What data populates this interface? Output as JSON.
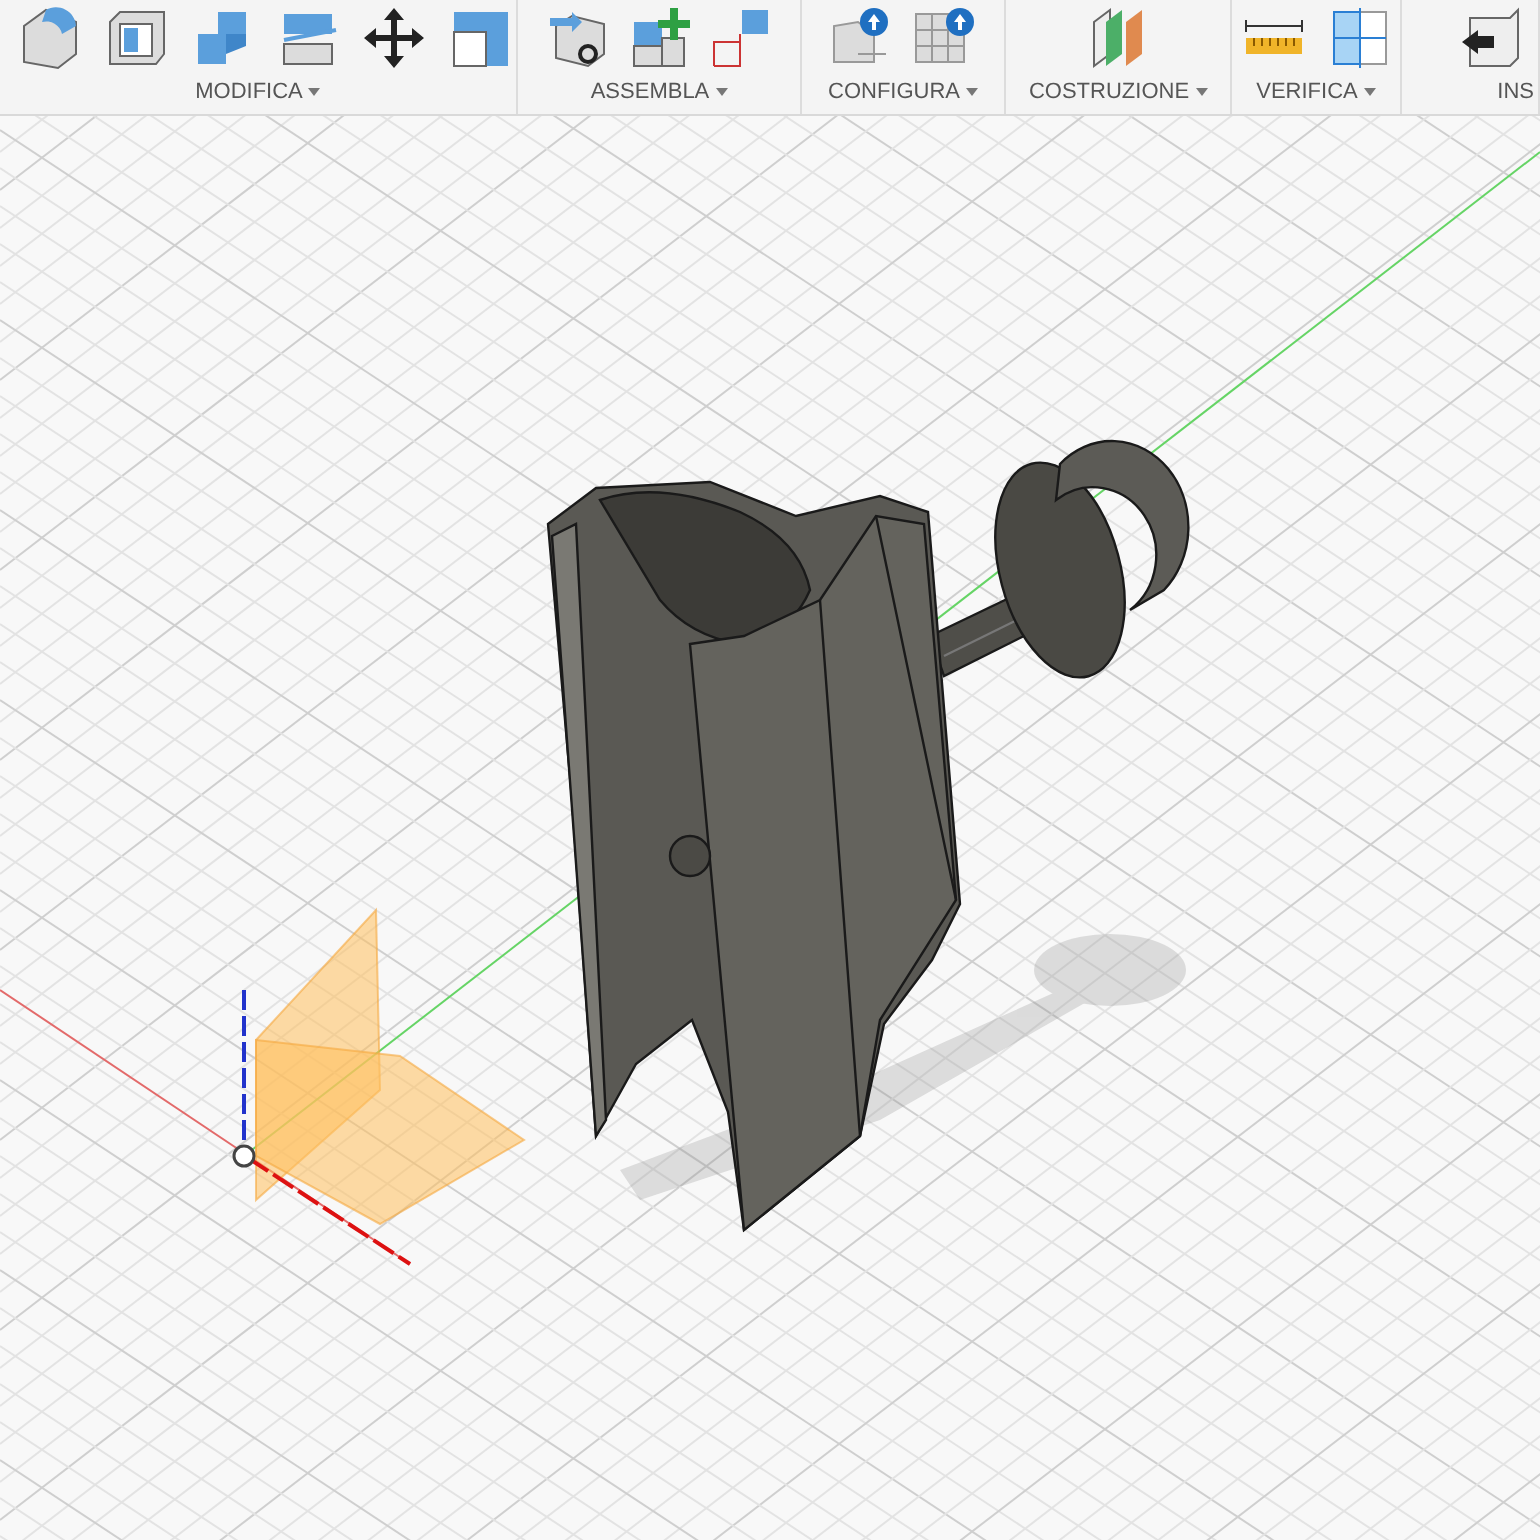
{
  "toolbar": {
    "groups": [
      {
        "label": "MODIFICA",
        "dropdown": true
      },
      {
        "label": "ASSEMBLA",
        "dropdown": true
      },
      {
        "label": "CONFIGURA",
        "dropdown": true
      },
      {
        "label": "COSTRUZIONE",
        "dropdown": true
      },
      {
        "label": "VERIFICA",
        "dropdown": true
      },
      {
        "label": "INS",
        "dropdown": false
      }
    ]
  }
}
